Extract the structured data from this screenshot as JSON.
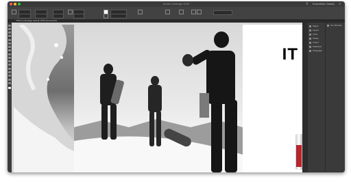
{
  "window": {
    "title": "Adobe InDesign 2020",
    "workspace_label": "Essentials Classic",
    "traffic_lights": [
      "#ff5f57",
      "#ffbd2e",
      "#28c840"
    ]
  },
  "document_tab": {
    "label": "*Winter Campaign.indd @ 100% [Converted]"
  },
  "canvas": {
    "headline_text": "IT"
  },
  "panels": {
    "left_column": [
      {
        "icon": "pages-icon",
        "label": "Pages"
      },
      {
        "icon": "layers-icon",
        "label": "Layers"
      },
      {
        "icon": "links-icon",
        "label": "Links"
      },
      {
        "icon": "stroke-icon",
        "label": "Stroke"
      },
      {
        "icon": "color-icon",
        "label": "Colour"
      },
      {
        "icon": "swatches-icon",
        "label": "Swatches"
      },
      {
        "icon": "paragraph-icon",
        "label": "Paragraph"
      }
    ],
    "right_column": [
      {
        "icon": "cc-libraries-icon",
        "label": "CC Libraries"
      }
    ]
  }
}
